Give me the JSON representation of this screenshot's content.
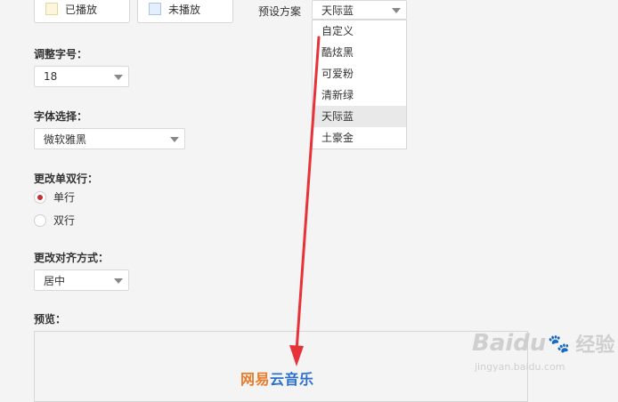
{
  "top_buttons": {
    "played_label": "已播放",
    "played_color": "#fdf6d8",
    "unplayed_label": "未播放",
    "unplayed_color": "#e3efff"
  },
  "preset": {
    "label": "预设方案",
    "selected": "天际蓝",
    "options": [
      "自定义",
      "酷炫黑",
      "可爱粉",
      "清新绿",
      "天际蓝",
      "土豪金"
    ]
  },
  "font_size": {
    "label": "调整字号：",
    "value": "18"
  },
  "font_family": {
    "label": "字体选择：",
    "value": "微软雅黑"
  },
  "line_mode": {
    "label": "更改单双行：",
    "options": [
      {
        "label": "单行",
        "checked": true
      },
      {
        "label": "双行",
        "checked": false
      }
    ]
  },
  "alignment": {
    "label": "更改对齐方式：",
    "value": "居中"
  },
  "preview": {
    "label": "预览：",
    "text_part1": "网易",
    "text_part2": "云音乐",
    "text_color1": "#e87c2a",
    "text_color2": "#2b6fd0"
  },
  "watermark": {
    "brand": "Baidu",
    "sub": "经验",
    "url": "jingyan.baidu.com"
  },
  "accent_color": "#c62f2f",
  "annotation_arrow_color": "#e8323a"
}
